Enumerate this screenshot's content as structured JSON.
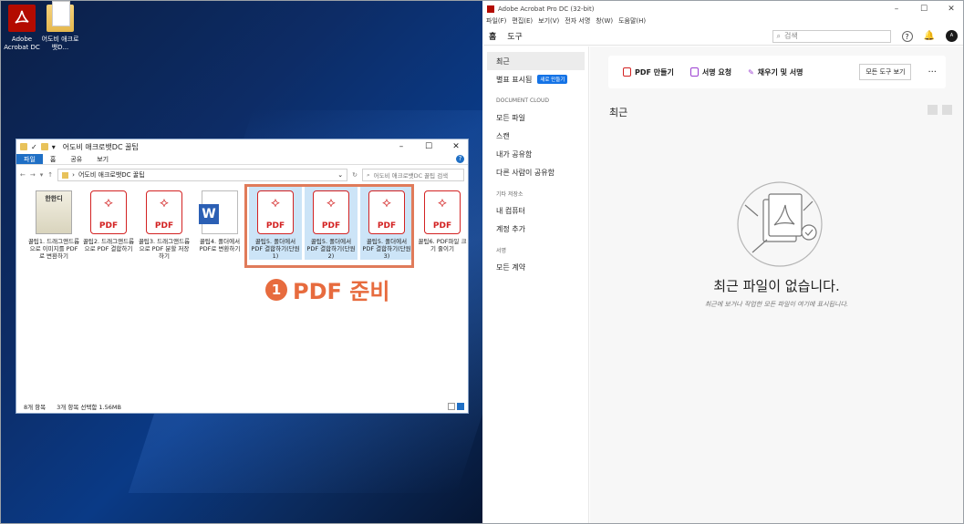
{
  "desktop": {
    "icons": [
      {
        "label": "Adobe Acrobat DC"
      },
      {
        "label": "어도비 애크로뱃D..."
      }
    ]
  },
  "explorer": {
    "title": "어도비 애크로뱃DC 꿀팁",
    "ribbon_tabs": [
      "파일",
      "홈",
      "공유",
      "보기"
    ],
    "address": "어도비 애크로뱃DC 꿀팁",
    "search_placeholder": "어도비 애크로뱃DC 꿀팁 검색",
    "files": [
      {
        "name": "꿀팁1. 드래그앤드롭으로 이미지를 PDF로 변환하기",
        "type": "book",
        "thumb_text": "한한디",
        "selected": false
      },
      {
        "name": "꿀팁2. 드래그앤드롭으로 PDF 결합하기",
        "type": "pdf",
        "selected": false
      },
      {
        "name": "꿀팁3. 드래그앤드롭으로 PDF 분할 저장하기",
        "type": "pdf",
        "selected": false
      },
      {
        "name": "꿀팁4. 폴더에서 PDF로 변환하기",
        "type": "word",
        "selected": false
      },
      {
        "name": "꿀팁5. 폴더에서 PDF 결합하기(단원1)",
        "type": "pdf",
        "selected": true
      },
      {
        "name": "꿀팁5. 폴더에서 PDF 결합하기(단원2)",
        "type": "pdf",
        "selected": true
      },
      {
        "name": "꿀팁5. 폴더에서 PDF 결합하기(단원3)",
        "type": "pdf",
        "selected": true
      },
      {
        "name": "꿀팁6. PDF파일 크기 줄이기",
        "type": "pdf",
        "selected": false
      }
    ],
    "pdf_label": "PDF",
    "status_count": "8개 항목",
    "status_selected": "3개 항목 선택함 1.56MB"
  },
  "step": {
    "number": "1",
    "label": "PDF 준비"
  },
  "acrobat": {
    "title": "Adobe Acrobat Pro DC (32-bit)",
    "menu": [
      "파일(F)",
      "편집(E)",
      "보기(V)",
      "전자 서명",
      "창(W)",
      "도움말(H)"
    ],
    "top_tabs": [
      "홈",
      "도구"
    ],
    "search_placeholder": "검색",
    "avatar_text": "A",
    "sidebar": {
      "recent": "최근",
      "starred": "별표 표시됨",
      "new_badge": "새로 만들기",
      "section_cloud": "DOCUMENT CLOUD",
      "cloud_items": [
        "모든 파일",
        "스캔",
        "내가 공유함",
        "다른 사람이 공유함"
      ],
      "section_other": "기타 저장소",
      "other_items": [
        "내 컴퓨터",
        "계정 추가"
      ],
      "section_sign": "서명",
      "sign_items": [
        "모든 계약"
      ]
    },
    "tools": {
      "create_pdf": "PDF 만들기",
      "request_sign": "서명 요청",
      "fill_sign": "채우기 및 서명",
      "all_tools": "모든 도구 보기",
      "more": "···"
    },
    "recent_heading": "최근",
    "empty_title": "최근 파일이 없습니다.",
    "empty_sub": "최근에 보거나 작업한 모든 파일이 여기에 표시됩니다."
  },
  "colors": {
    "accent": "#e76b3e",
    "acrobat_red": "#b30b00",
    "pdf_red": "#d32222",
    "select_blue": "#cce4f7"
  }
}
